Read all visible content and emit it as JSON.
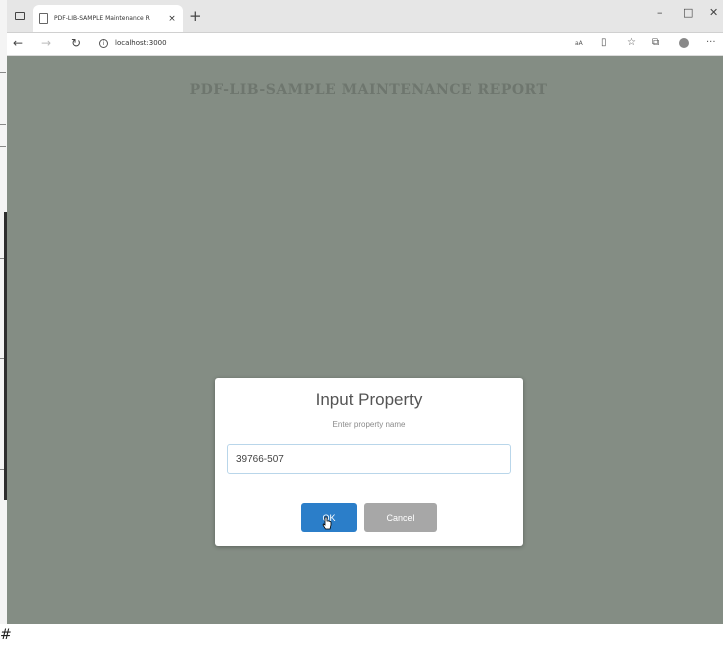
{
  "browser": {
    "tab_title": "PDF-LIB-SAMPLE Maintenance R",
    "tab_close": "×",
    "new_tab": "+",
    "url": "localhost:3000",
    "window_controls": {
      "minimize": "–",
      "maximize": "□",
      "close": "✕"
    },
    "toolbar": {
      "reader_mode": "aA",
      "more": "···"
    }
  },
  "page": {
    "report_title": "PDF-LIB-SAMPLE MAINTENANCE REPORT"
  },
  "dialog": {
    "title": "Input Property",
    "text": "Enter property name",
    "input_value": "39766-507",
    "ok_label": "OK",
    "cancel_label": "Cancel"
  },
  "desktop": {
    "bottom_glyph": "#"
  },
  "colors": {
    "page_background": "#848d84",
    "ok_button": "#2b7ec9",
    "cancel_button": "#a7a7a7"
  }
}
